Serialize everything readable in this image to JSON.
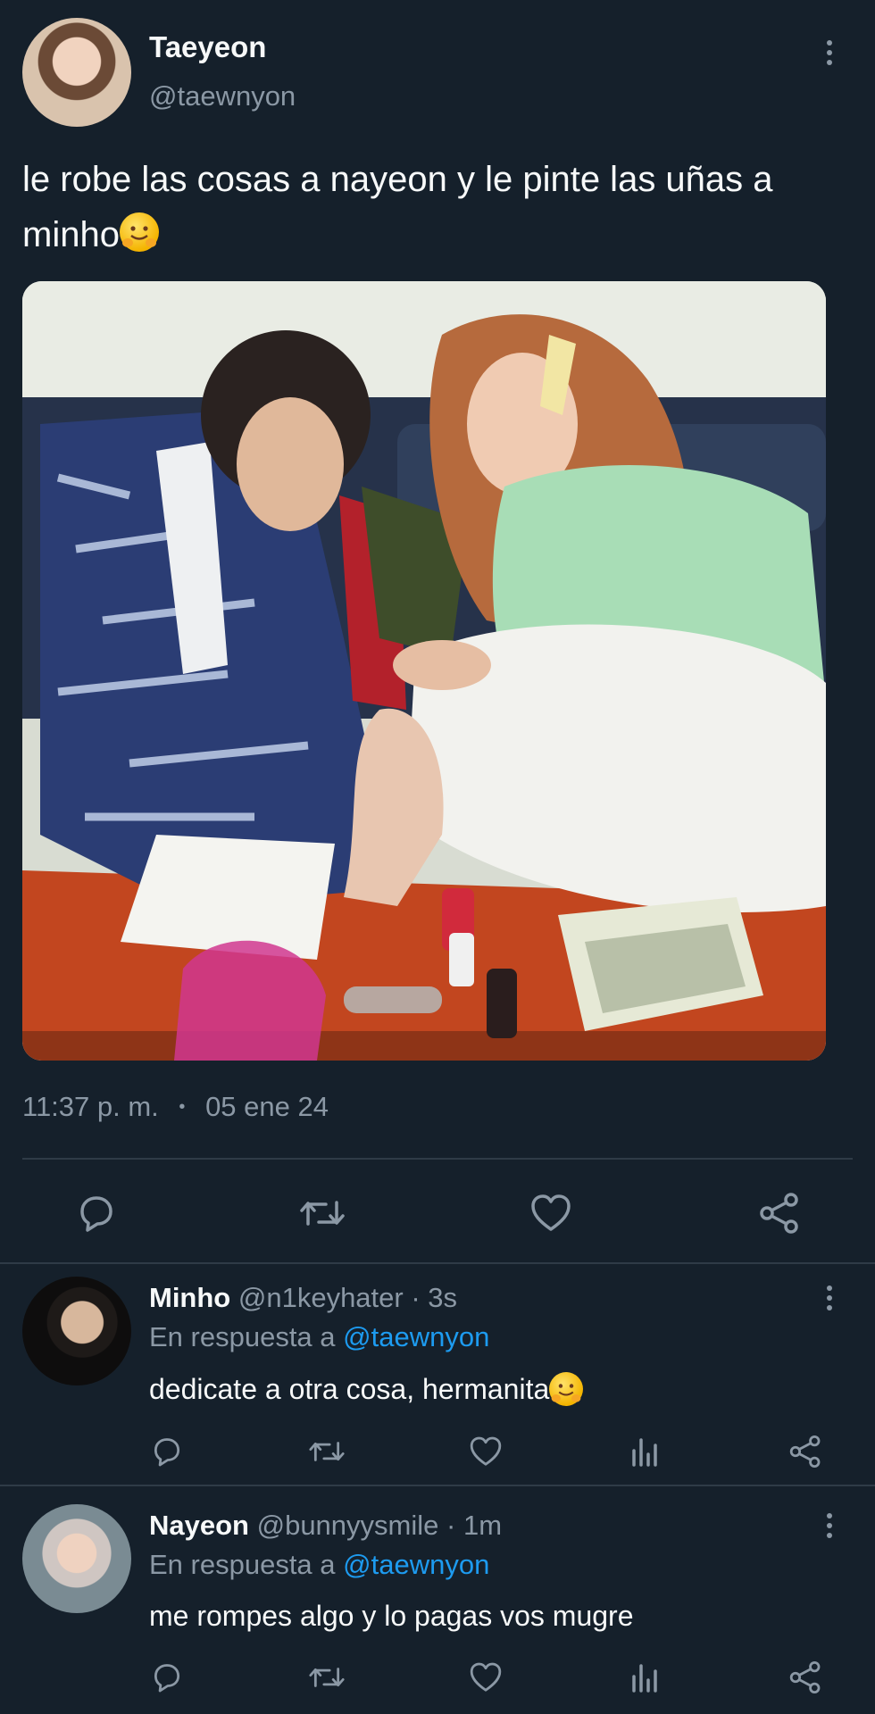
{
  "tweet": {
    "display_name": "Taeyeon",
    "handle": "@taewnyon",
    "text": "le robe las cosas a nayeon y le pinte las uñas a minho",
    "emoji": "hugging-face",
    "time": "11:37 p. m.",
    "separator": "•",
    "date": "05 ene 24"
  },
  "replies": [
    {
      "display_name": "Minho",
      "handle": "@n1keyhater",
      "age": "· 3s",
      "reply_prefix": "En respuesta a",
      "reply_to": "@taewnyon",
      "text": "dedicate a otra cosa, hermanita",
      "emoji": "hugging-face"
    },
    {
      "display_name": "Nayeon",
      "handle": "@bunnyysmile",
      "age": "· 1m",
      "reply_prefix": "En respuesta a",
      "reply_to": "@taewnyon",
      "text": "me rompes algo y lo pagas vos mugre"
    }
  ],
  "colors": {
    "background": "#15202b",
    "text": "#f7f9f9",
    "muted": "#8b98a5",
    "link": "#1d9bf0",
    "divider": "#2f3b47"
  }
}
